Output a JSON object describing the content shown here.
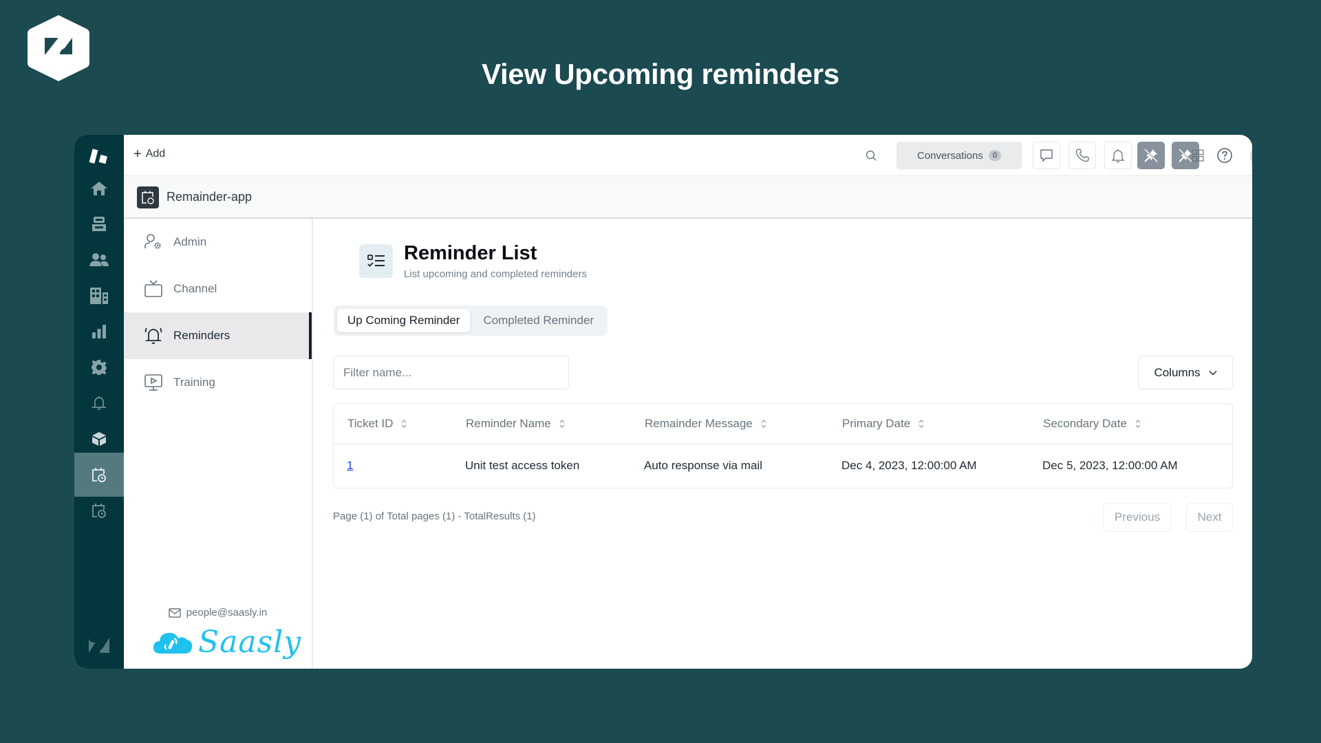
{
  "page_heading": "View Upcoming reminders",
  "topbar": {
    "add_label": "Add",
    "conversations_label": "Conversations",
    "conversations_count": "0"
  },
  "app": {
    "name": "Remainder-app"
  },
  "rail": {
    "items": [
      {
        "icon": "zendesk-support-logo-icon"
      },
      {
        "icon": "home-icon"
      },
      {
        "icon": "inbox-icon"
      },
      {
        "icon": "customers-icon"
      },
      {
        "icon": "organizations-icon"
      },
      {
        "icon": "reporting-icon"
      },
      {
        "icon": "settings-gear-icon"
      },
      {
        "icon": "bell-icon"
      },
      {
        "icon": "cube-icon"
      },
      {
        "icon": "calendar-alarm-icon",
        "active": true
      },
      {
        "icon": "calendar-alarm-icon"
      },
      {
        "icon": "zendesk-logo-icon"
      }
    ]
  },
  "nav": {
    "items": [
      {
        "label": "Admin",
        "icon": "user-gear-icon"
      },
      {
        "label": "Channel",
        "icon": "tv-icon"
      },
      {
        "label": "Reminders",
        "icon": "bell-ringing-icon",
        "active": true
      },
      {
        "label": "Training",
        "icon": "presentation-play-icon"
      }
    ],
    "footer_email": "people@saasly.in",
    "brand_name": "Saasly"
  },
  "main": {
    "title": "Reminder List",
    "subtitle": "List upcoming and completed reminders",
    "tabs": [
      {
        "label": "Up Coming Reminder",
        "active": true
      },
      {
        "label": "Completed Reminder",
        "active": false
      }
    ],
    "filter": {
      "placeholder": "Filter name...",
      "value": ""
    },
    "columns_label": "Columns",
    "table": {
      "headers": [
        "Ticket ID",
        "Reminder Name",
        "Remainder Message",
        "Primary Date",
        "Secondary Date"
      ],
      "rows": [
        [
          "1",
          "Unit test access token",
          "Auto response via mail",
          "Dec 4, 2023, 12:00:00 AM",
          "Dec 5, 2023, 12:00:00 AM"
        ]
      ]
    },
    "pagination": {
      "summary": "Page (1) of Total pages (1) - TotalResults (1)",
      "previous_label": "Previous",
      "next_label": "Next"
    }
  },
  "colors": {
    "background": "#1b4a50",
    "rail": "#03363d",
    "rail_active": "#547a80",
    "link": "#1a3ee0",
    "saasly_brand": "#1fc1ef"
  }
}
